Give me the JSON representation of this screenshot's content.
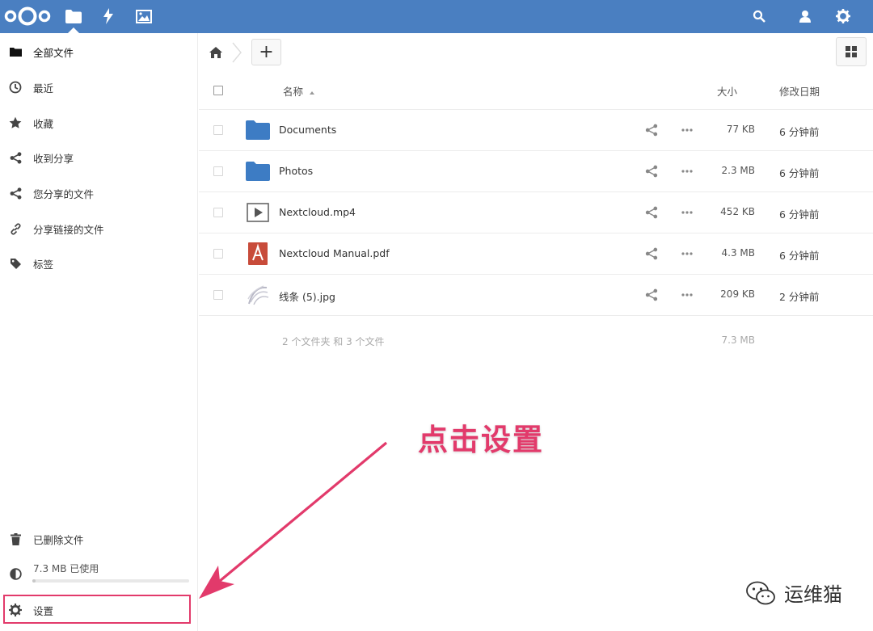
{
  "header": {
    "logo_name": "nextcloud-logo",
    "apps": [
      "folder-icon",
      "activity-icon",
      "gallery-icon"
    ],
    "right_icons": [
      "search-icon",
      "contacts-icon",
      "settings-icon"
    ]
  },
  "sidebar": {
    "items": [
      {
        "label": "全部文件",
        "icon": "folder-icon"
      },
      {
        "label": "最近",
        "icon": "clock-icon"
      },
      {
        "label": "收藏",
        "icon": "star-icon"
      },
      {
        "label": "收到分享",
        "icon": "share-icon"
      },
      {
        "label": "您分享的文件",
        "icon": "share-icon"
      },
      {
        "label": "分享链接的文件",
        "icon": "link-icon"
      },
      {
        "label": "标签",
        "icon": "tag-icon"
      }
    ],
    "deleted": "已删除文件",
    "quota": "7.3 MB 已使用",
    "quota_fraction": 0.02,
    "settings": "设置"
  },
  "controls": {
    "add_label": "+"
  },
  "table": {
    "headers": {
      "name": "名称",
      "size": "大小",
      "modified": "修改日期"
    },
    "rows": [
      {
        "name": "Documents",
        "type": "folder",
        "size": "77 KB",
        "modified": "6 分钟前"
      },
      {
        "name": "Photos",
        "type": "folder",
        "size": "2.3 MB",
        "modified": "6 分钟前"
      },
      {
        "name": "Nextcloud.mp4",
        "type": "video",
        "size": "452 KB",
        "modified": "6 分钟前"
      },
      {
        "name": "Nextcloud Manual.pdf",
        "type": "pdf",
        "size": "4.3 MB",
        "modified": "6 分钟前"
      },
      {
        "name": "线条 (5).jpg",
        "type": "image",
        "size": "209 KB",
        "modified": "2 分钟前"
      }
    ],
    "summary": {
      "text": "2 个文件夹 和 3 个文件",
      "size": "7.3 MB"
    }
  },
  "annotation": "点击设置",
  "watermark": "运维猫",
  "colors": {
    "header": "#4a7fc1",
    "folder": "#3d7cc4",
    "pdf": "#c84b3a",
    "annotation": "#e23a6b"
  }
}
